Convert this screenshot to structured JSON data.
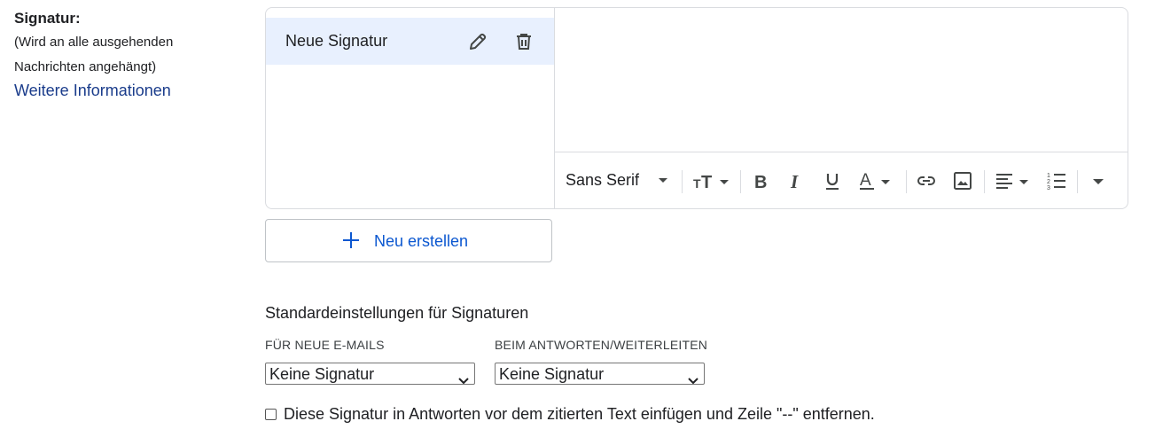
{
  "section": {
    "title": "Signatur:",
    "description_line1": "(Wird an alle ausgehenden",
    "description_line2": "Nachrichten angehängt)",
    "more_info_link": "Weitere Informationen"
  },
  "signatures": [
    {
      "name": "Neue Signatur",
      "selected": true
    }
  ],
  "toolbar": {
    "font_family": "Sans Serif",
    "buttons": [
      "font-size-icon",
      "bold-icon",
      "italic-icon",
      "underline-icon",
      "text-color-icon",
      "link-icon",
      "image-icon",
      "align-icon",
      "numbered-list-icon",
      "more-options-icon"
    ]
  },
  "new_button": {
    "label": "Neu erstellen"
  },
  "defaults": {
    "title": "Standardeinstellungen für Signaturen",
    "new_emails_label": "FÜR NEUE E-MAILS",
    "new_emails_value": "Keine Signatur",
    "reply_label": "BEIM ANTWORTEN/WEITERLEITEN",
    "reply_value": "Keine Signatur"
  },
  "checkbox": {
    "label": "Diese Signatur in Antworten vor dem zitierten Text einfügen und Zeile \"--\" entfernen.",
    "checked": false
  },
  "colors": {
    "accent": "#0b57d0",
    "link": "#1a3c8b",
    "selected_bg": "#e8f0fe",
    "border": "#dadce0"
  }
}
